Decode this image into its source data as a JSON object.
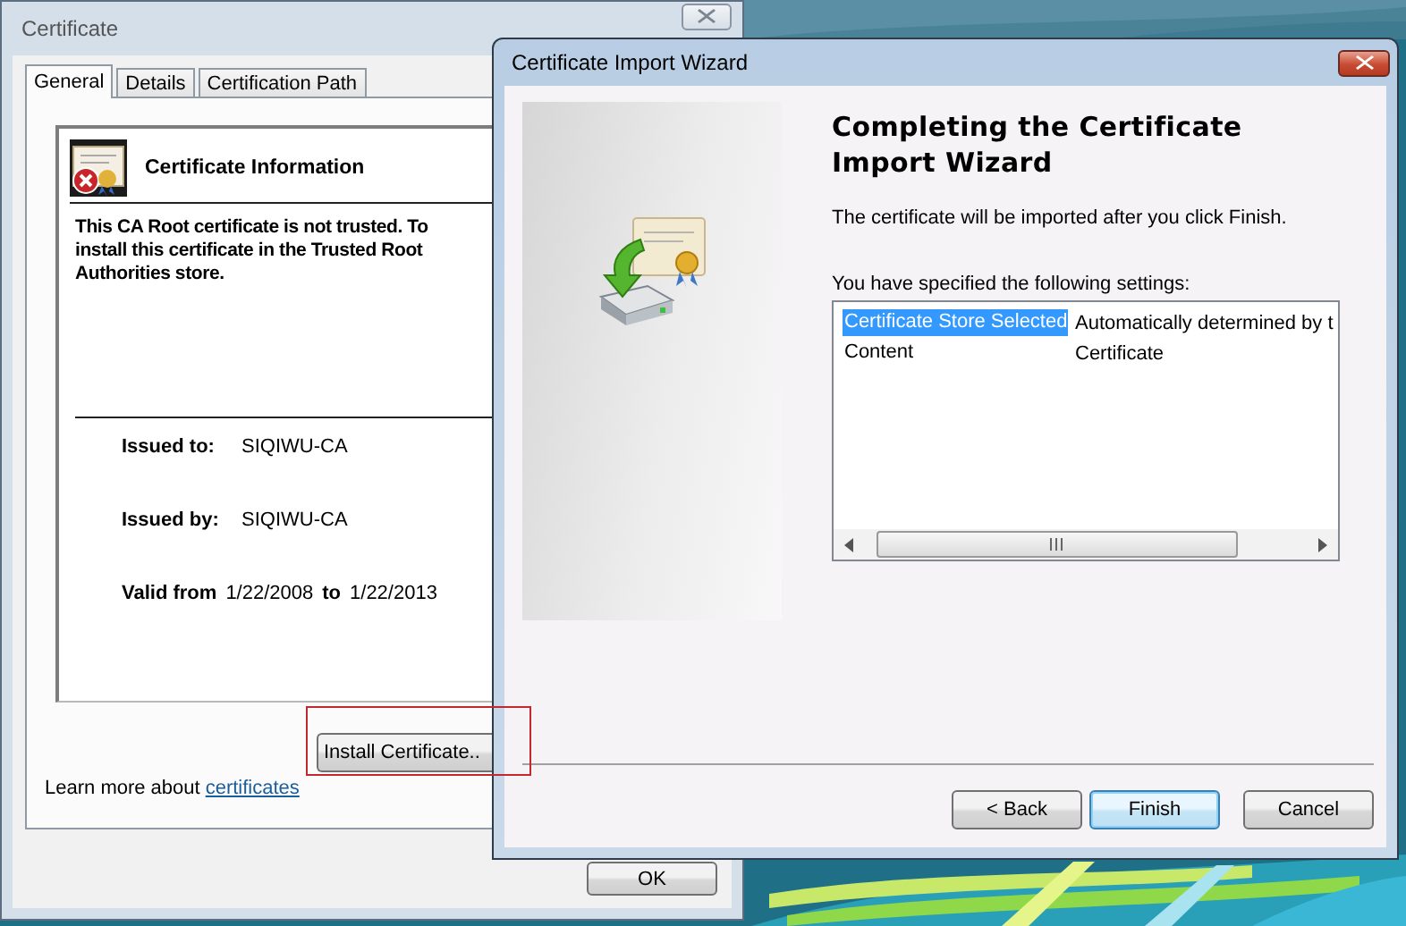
{
  "certificate_window": {
    "title": "Certificate",
    "tabs": [
      {
        "label": "General",
        "selected": true
      },
      {
        "label": "Details",
        "selected": false
      },
      {
        "label": "Certification Path",
        "selected": false
      }
    ],
    "info_title": "Certificate Information",
    "warning_lines": [
      "This CA Root certificate is not trusted. To",
      "install this certificate in the Trusted Root",
      "Authorities store."
    ],
    "fields": [
      {
        "label": "Issued to:",
        "value": "SIQIWU-CA"
      },
      {
        "label": "Issued by:",
        "value": "SIQIWU-CA"
      }
    ],
    "validity": {
      "label": "Valid from",
      "from": "1/22/2008",
      "separator": "to",
      "to": "1/22/2013"
    },
    "install_button": "Install Certificate..",
    "learn_more": {
      "text": "Learn more about",
      "link": "certificates"
    },
    "ok_button": "OK"
  },
  "wizard_window": {
    "title": "Certificate Import Wizard",
    "heading": "Completing the Certificate Import Wizard",
    "message": "The certificate will be imported after you click Finish.",
    "settings_label": "You have specified the following settings:",
    "settings": [
      {
        "name": "Certificate Store Selected",
        "value": "Automatically determined by t",
        "selected": true
      },
      {
        "name": "Content",
        "value": "Certificate",
        "selected": false
      }
    ],
    "buttons": [
      {
        "label": "< Back",
        "default": false
      },
      {
        "label": "Finish",
        "default": true
      },
      {
        "label": "Cancel",
        "default": false
      }
    ]
  }
}
